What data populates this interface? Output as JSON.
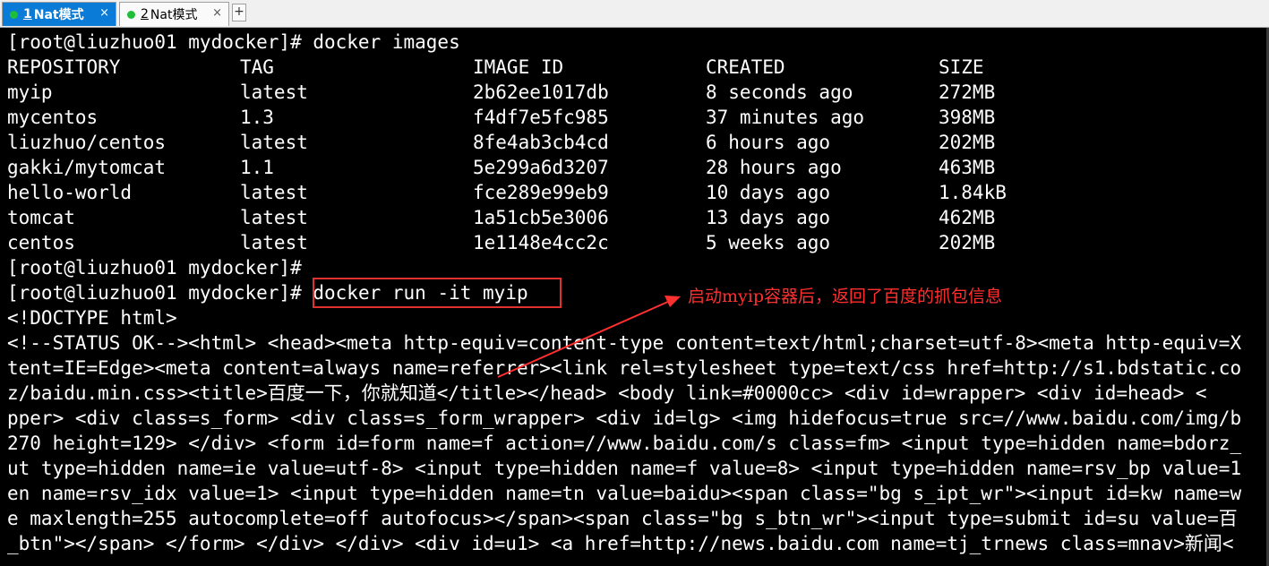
{
  "tabs": [
    {
      "number": "1",
      "label": "Nat模式",
      "close": "×"
    },
    {
      "number": "2",
      "label": "Nat模式",
      "close": "×"
    }
  ],
  "tab_add": "+",
  "terminal": {
    "prompt1": "[root@liuzhuo01 mydocker]# docker images",
    "table": {
      "headers": [
        "REPOSITORY",
        "TAG",
        "IMAGE ID",
        "CREATED",
        "SIZE"
      ],
      "rows": [
        [
          "myip",
          "latest",
          "2b62ee1017db",
          "8 seconds ago",
          "272MB"
        ],
        [
          "mycentos",
          "1.3",
          "f4df7e5fc985",
          "37 minutes ago",
          "398MB"
        ],
        [
          "liuzhuo/centos",
          "latest",
          "8fe4ab3cb4cd",
          "6 hours ago",
          "202MB"
        ],
        [
          "gakki/mytomcat",
          "1.1",
          "5e299a6d3207",
          "28 hours ago",
          "463MB"
        ],
        [
          "hello-world",
          "latest",
          "fce289e99eb9",
          "10 days ago",
          "1.84kB"
        ],
        [
          "tomcat",
          "latest",
          "1a51cb5e3006",
          "13 days ago",
          "462MB"
        ],
        [
          "centos",
          "latest",
          "1e1148e4cc2c",
          "5 weeks ago",
          "202MB"
        ]
      ]
    },
    "prompt2": "[root@liuzhuo01 mydocker]#",
    "prompt3_prefix": "[root@liuzhuo01 mydocker]#",
    "prompt3_command": " docker run -it myip",
    "output": [
      "<!DOCTYPE html>",
      "<!--STATUS OK--><html> <head><meta http-equiv=content-type content=text/html;charset=utf-8><meta http-equiv=X",
      "tent=IE=Edge><meta content=always name=referrer><link rel=stylesheet type=text/css href=http://s1.bdstatic.co",
      "z/baidu.min.css><title>百度一下，你就知道</title></head> <body link=#0000cc> <div id=wrapper> <div id=head> <",
      "pper> <div class=s_form> <div class=s_form_wrapper> <div id=lg> <img hidefocus=true src=//www.baidu.com/img/b",
      "270 height=129> </div> <form id=form name=f action=//www.baidu.com/s class=fm> <input type=hidden name=bdorz_",
      "ut type=hidden name=ie value=utf-8> <input type=hidden name=f value=8> <input type=hidden name=rsv_bp value=1",
      "en name=rsv_idx value=1> <input type=hidden name=tn value=baidu><span class=\"bg s_ipt_wr\"><input id=kw name=w",
      "e maxlength=255 autocomplete=off autofocus></span><span class=\"bg s_btn_wr\"><input type=submit id=su value=百",
      "_btn\"></span> </form> </div> </div> <div id=u1> <a href=http://news.baidu.com name=tj_trnews class=mnav>新闻<"
    ]
  },
  "annotation": "启动myip容器后，返回了百度的抓包信息",
  "colors": {
    "tab_active_bg": "#0a7bd6",
    "status_dot": "#1fbf3a",
    "annotation_red": "#ff3030",
    "terminal_bg": "#000000",
    "terminal_fg": "#ffffff"
  }
}
